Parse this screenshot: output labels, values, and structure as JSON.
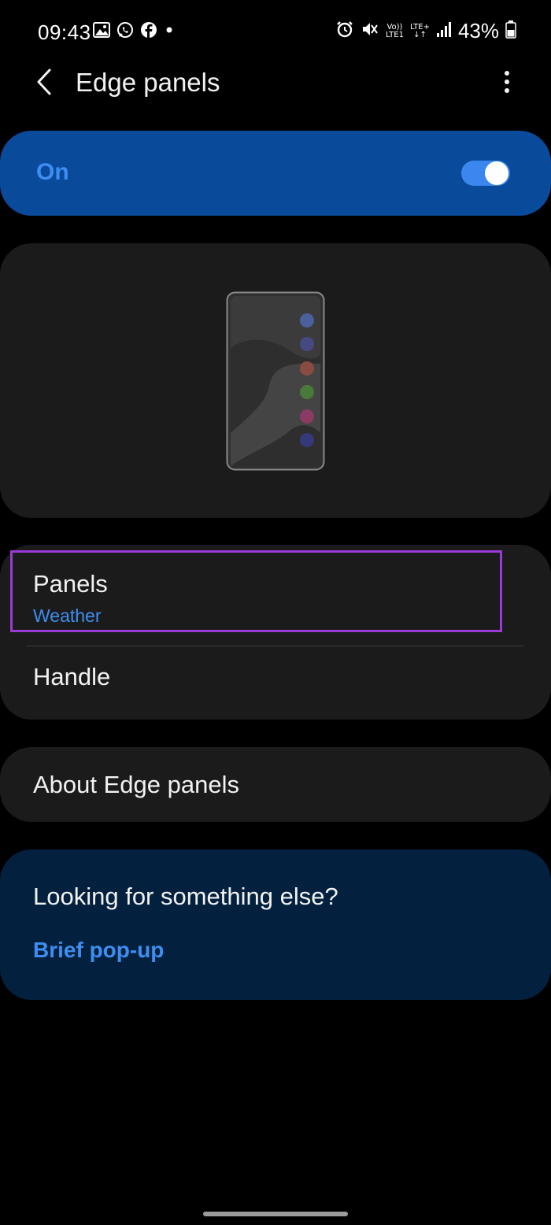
{
  "status_bar": {
    "time": "09:43",
    "left_icons": [
      "gallery-icon",
      "whatsapp-icon",
      "facebook-icon",
      "notification-dot-icon"
    ],
    "network_top": "Vo))",
    "network_bottom": "LTE1",
    "lte_label": "LTE+",
    "battery_percent": "43%"
  },
  "header": {
    "title": "Edge panels"
  },
  "toggle": {
    "label": "On",
    "state": true,
    "accent": "#3d8ef0"
  },
  "preview": {
    "dot_colors": [
      "#4b5f9a",
      "#474a82",
      "#8a4b42",
      "#4a7a3a",
      "#8a3a63",
      "#34397a"
    ]
  },
  "list": {
    "panels_title": "Panels",
    "panels_subtitle": "Weather",
    "handle_title": "Handle"
  },
  "about": {
    "title": "About Edge panels"
  },
  "suggest": {
    "title": "Looking for something else?",
    "link": "Brief pop-up"
  }
}
